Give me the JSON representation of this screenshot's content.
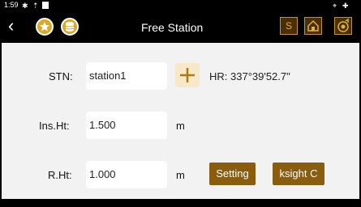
{
  "status_bar": {
    "time": "1:59"
  },
  "header": {
    "title": "Free Station",
    "s_label": "S"
  },
  "form": {
    "stn": {
      "label": "STN:",
      "value": "station1"
    },
    "hr": {
      "text": "HR: 337°39'52.7\""
    },
    "ins_ht": {
      "label": "Ins.Ht:",
      "value": "1.500",
      "unit": "m"
    },
    "r_ht": {
      "label": "R.Ht:",
      "value": "1.000",
      "unit": "m"
    },
    "setting_label": "Setting",
    "backsight_label": "ksight C"
  },
  "colors": {
    "accent": "#8a5c0d",
    "gold": "#d9a92b"
  }
}
